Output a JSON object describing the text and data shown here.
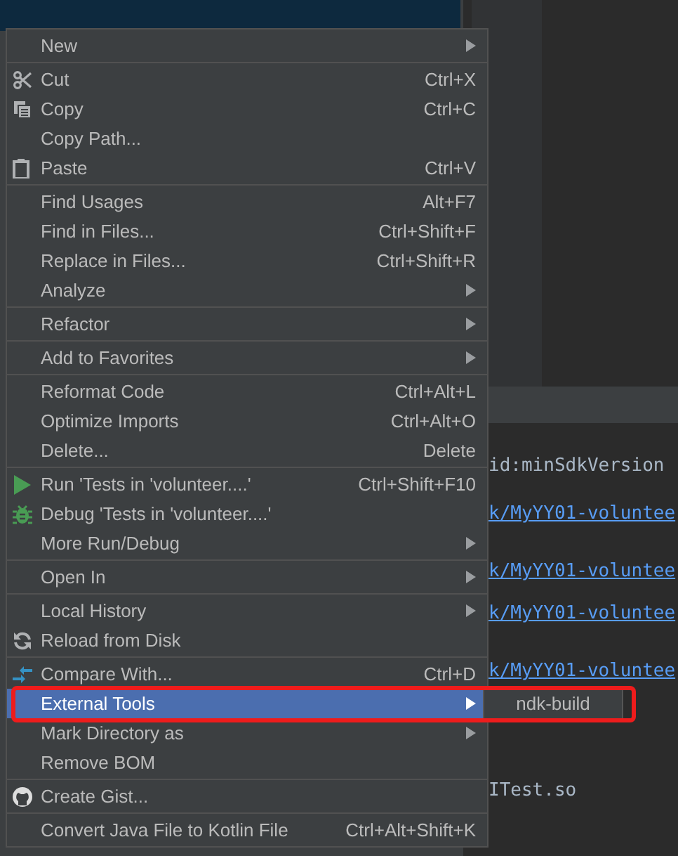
{
  "editor_lines": [
    {
      "text": "id:minSdkVersion",
      "kind": "plain"
    },
    {
      "text": "k/MyYY01-voluntee",
      "kind": "link"
    },
    {
      "text": "k/MyYY01-voluntee",
      "kind": "link"
    },
    {
      "text": "k/MyYY01-voluntee",
      "kind": "link"
    },
    {
      "text": "k/MyYY01-voluntee",
      "kind": "link"
    },
    {
      "text": "ITest.so",
      "kind": "plain"
    }
  ],
  "context_menu": {
    "groups": [
      [
        {
          "label": "New",
          "submenu": true,
          "selected": false
        }
      ],
      [
        {
          "label": "Cut",
          "shortcut": "Ctrl+X",
          "submenu": false,
          "kind": "cut",
          "selected": false
        },
        {
          "label": "Copy",
          "shortcut": "Ctrl+C",
          "submenu": false,
          "kind": "copy",
          "selected": false
        },
        {
          "label": "Copy Path...",
          "submenu": false,
          "selected": false
        },
        {
          "label": "Paste",
          "shortcut": "Ctrl+V",
          "submenu": false,
          "kind": "paste",
          "selected": false
        }
      ],
      [
        {
          "label": "Find Usages",
          "shortcut": "Alt+F7",
          "submenu": false,
          "selected": false
        },
        {
          "label": "Find in Files...",
          "shortcut": "Ctrl+Shift+F",
          "submenu": false,
          "selected": false
        },
        {
          "label": "Replace in Files...",
          "shortcut": "Ctrl+Shift+R",
          "submenu": false,
          "selected": false
        },
        {
          "label": "Analyze",
          "submenu": true,
          "selected": false
        }
      ],
      [
        {
          "label": "Refactor",
          "submenu": true,
          "selected": false
        }
      ],
      [
        {
          "label": "Add to Favorites",
          "submenu": true,
          "selected": false
        }
      ],
      [
        {
          "label": "Reformat Code",
          "shortcut": "Ctrl+Alt+L",
          "submenu": false,
          "selected": false
        },
        {
          "label": "Optimize Imports",
          "shortcut": "Ctrl+Alt+O",
          "submenu": false,
          "selected": false
        },
        {
          "label": "Delete...",
          "shortcut": "Delete",
          "submenu": false,
          "selected": false
        }
      ],
      [
        {
          "label": "Run 'Tests in 'volunteer....'",
          "shortcut": "Ctrl+Shift+F10",
          "submenu": false,
          "kind": "run",
          "selected": false
        },
        {
          "label": "Debug 'Tests in 'volunteer....'",
          "submenu": false,
          "kind": "debug",
          "selected": false
        },
        {
          "label": "More Run/Debug",
          "submenu": true,
          "selected": false
        }
      ],
      [
        {
          "label": "Open In",
          "submenu": true,
          "selected": false
        }
      ],
      [
        {
          "label": "Local History",
          "submenu": true,
          "selected": false
        },
        {
          "label": "Reload from Disk",
          "submenu": false,
          "kind": "reload",
          "selected": false
        }
      ],
      [
        {
          "label": "Compare With...",
          "shortcut": "Ctrl+D",
          "submenu": false,
          "kind": "compare",
          "selected": false
        },
        {
          "label": "External Tools",
          "submenu": true,
          "selected": true
        },
        {
          "label": "Mark Directory as",
          "submenu": true,
          "selected": false
        },
        {
          "label": "Remove BOM",
          "submenu": false,
          "selected": false
        }
      ],
      [
        {
          "label": "Create Gist...",
          "submenu": false,
          "kind": "github",
          "selected": false
        }
      ],
      [
        {
          "label": "Convert Java File to Kotlin File",
          "shortcut": "Ctrl+Alt+Shift+K",
          "submenu": false,
          "selected": false
        }
      ]
    ]
  },
  "submenu": {
    "items": [
      "ndk-build"
    ]
  }
}
